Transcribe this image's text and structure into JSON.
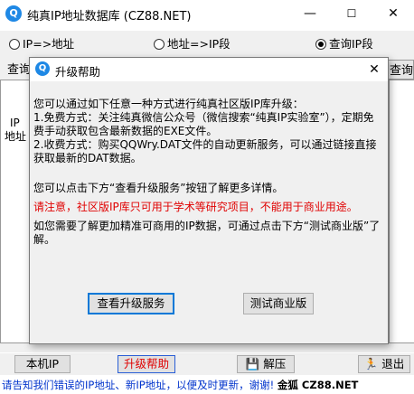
{
  "main_window": {
    "title": "纯真IP地址数据库 (CZ88.NET)",
    "icon": "app-logo-icon",
    "controls": {
      "minimize": "—",
      "maximize": "☐",
      "close": "✕"
    }
  },
  "modes": [
    {
      "label": "IP=>地址",
      "selected": false
    },
    {
      "label": "地址=>IP段",
      "selected": false
    },
    {
      "label": "查询IP段",
      "selected": true
    }
  ],
  "background": {
    "query_left": "查询",
    "query_right": "查询",
    "list_col_1": "IP",
    "list_col_2": "地址"
  },
  "bottom_buttons": {
    "local_ip": "本机IP",
    "upgrade_help": "升级帮助",
    "extract": "解压",
    "exit": "退出"
  },
  "status_bar": {
    "message": "请告知我们错误的IP地址、新IP地址，以便及时更新，谢谢!",
    "brand": "金狐 CZ88.NET"
  },
  "dialog": {
    "title": "升级帮助",
    "close": "✕",
    "paragraph_1": "您可以通过如下任意一种方式进行纯真社区版IP库升级：",
    "paragraph_2": "1.免费方式：关注纯真微信公众号（微信搜索“纯真IP实验室”），定期免费手动获取包含最新数据的EXE文件。",
    "paragraph_3": "2.收费方式：购买QQWry.DAT文件的自动更新服务，可以通过链接直接获取最新的DAT数据。",
    "paragraph_4": "您可以点击下方“查看升级服务”按钮了解更多详情。",
    "notice": "请注意，社区版IP库只可用于学术等研究项目，不能用于商业用途。",
    "paragraph_5": "如您需要了解更加精准可商用的IP数据，可通过点击下方“测试商业版”了解。",
    "view_service_button": "查看升级服务",
    "test_commercial_button": "测试商业版"
  },
  "colors": {
    "accent_blue": "#1e88e5",
    "warning_red": "#e00000",
    "status_blue": "#0033cc"
  }
}
